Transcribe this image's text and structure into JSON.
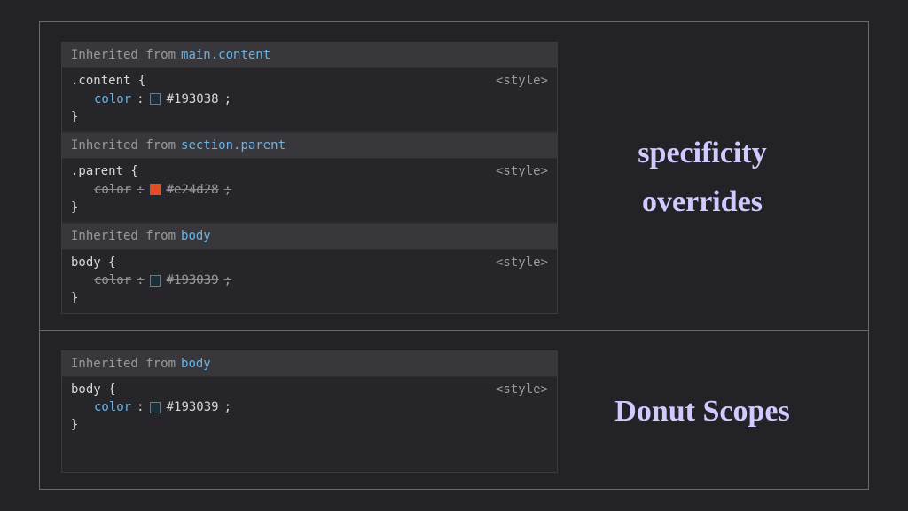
{
  "labels": {
    "inherited_from": "Inherited from",
    "origin_style": "<style>"
  },
  "captions": {
    "top_line1": "specificity",
    "top_line2": "overrides",
    "bottom": "Donut Scopes"
  },
  "top_panel": {
    "blocks": [
      {
        "inherit_selector": "main.content",
        "rule_selector": ".content {",
        "close": "}",
        "prop": "color",
        "value": "#193038",
        "swatch": "#193038",
        "struck": false
      },
      {
        "inherit_selector": "section.parent",
        "rule_selector": ".parent {",
        "close": "}",
        "prop": "color",
        "value": "#e24d28",
        "swatch": "#e24d28",
        "struck": true
      },
      {
        "inherit_selector": "body",
        "rule_selector": "body {",
        "close": "}",
        "prop": "color",
        "value": "#193039",
        "swatch": "#193039",
        "struck": true
      }
    ]
  },
  "bottom_panel": {
    "blocks": [
      {
        "inherit_selector": "body",
        "rule_selector": "body {",
        "close": "}",
        "prop": "color",
        "value": "#193039",
        "swatch": "#193039",
        "struck": false
      }
    ]
  }
}
